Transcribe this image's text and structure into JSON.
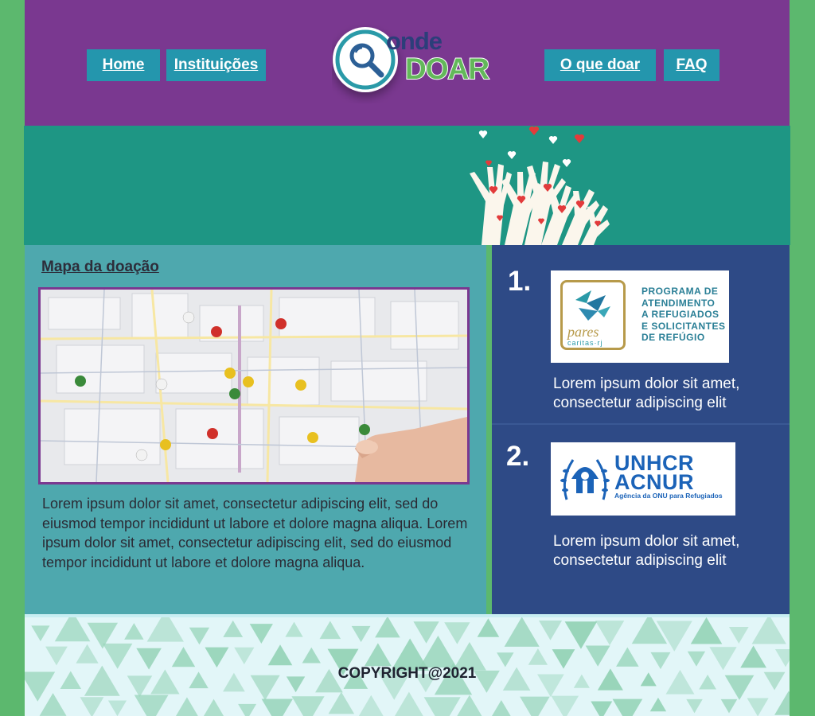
{
  "nav": {
    "home": "Home",
    "instituicoes": "Instituições",
    "o_que_doar": "O que doar",
    "faq": "FAQ"
  },
  "logo": {
    "word1": "onde",
    "word2": "DOAR"
  },
  "map_section": {
    "title": "Mapa da doação",
    "body": "Lorem ipsum dolor sit amet, consectetur adipiscing elit, sed do eiusmod tempor incididunt ut labore et dolore magna aliqua. Lorem ipsum dolor sit amet, consectetur adipiscing elit, sed do eiusmod tempor incididunt ut labore et dolore magna aliqua."
  },
  "orgs": [
    {
      "number": "1.",
      "brand": "pares",
      "brand_sub": "caritas·rj",
      "program_lines": [
        "PROGRAMA DE",
        "ATENDIMENTO",
        "A REFUGIADOS",
        "E SOLICITANTES",
        "DE REFÚGIO"
      ],
      "description": "Lorem ipsum dolor sit amet, consectetur adipiscing elit"
    },
    {
      "number": "2.",
      "brand_line1": "UNHCR",
      "brand_line2": "ACNUR",
      "brand_sub": "Agência da ONU para Refugiados",
      "description": "Lorem ipsum dolor sit amet, consectetur adipiscing elit"
    }
  ],
  "footer": {
    "copyright": "COPYRIGHT@2021"
  },
  "colors": {
    "header_bg": "#7a3890",
    "nav_bg": "#2496ad",
    "banner_bg": "#1e9684",
    "left_bg": "#4ea8ae",
    "right_bg": "#2e4a86",
    "page_bg": "#5cb86e"
  }
}
